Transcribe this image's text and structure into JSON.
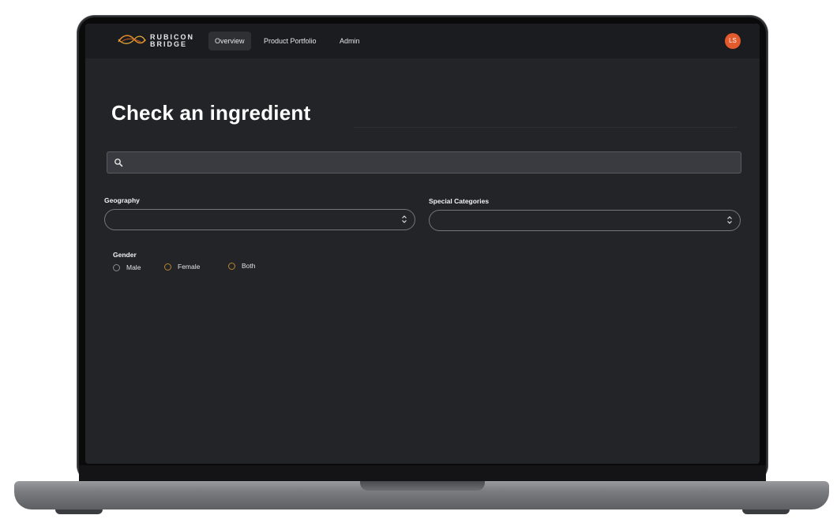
{
  "brand": {
    "line1": "RUBICON",
    "line2": "BRIDGE"
  },
  "nav": {
    "items": [
      {
        "label": "Overview",
        "active": true
      },
      {
        "label": "Product Portfolio",
        "active": false
      },
      {
        "label": "Admin",
        "active": false
      }
    ],
    "avatar_initials": "LS",
    "avatar_color": "#e45a2c"
  },
  "page": {
    "title": "Check an ingredient"
  },
  "search": {
    "value": "",
    "placeholder": "",
    "icon": "search-icon"
  },
  "filters": {
    "geography": {
      "label": "Geography",
      "value": ""
    },
    "special_categories": {
      "label": "Special Categories",
      "value": ""
    }
  },
  "gender": {
    "label": "Gender",
    "options": [
      "Male",
      "Female",
      "Both"
    ],
    "selected": null
  }
}
